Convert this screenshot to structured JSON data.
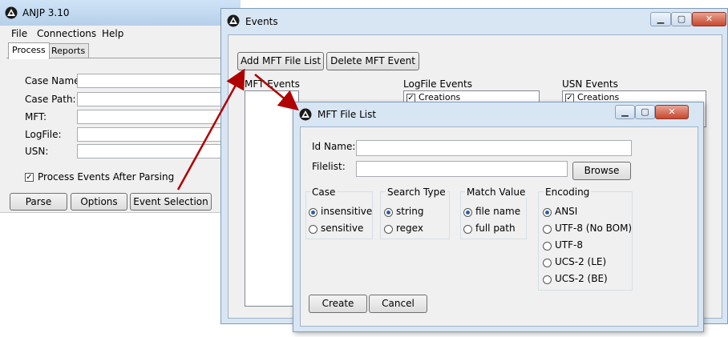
{
  "main_window": {
    "title": "ANJP 3.10",
    "menu": [
      "File",
      "Connections",
      "Help"
    ],
    "tabs": [
      "Process",
      "Reports"
    ],
    "fields": [
      {
        "label": "Case Name:",
        "value": ""
      },
      {
        "label": "Case Path:",
        "value": ""
      },
      {
        "label": "MFT:",
        "value": ""
      },
      {
        "label": "LogFile:",
        "value": ""
      },
      {
        "label": "USN:",
        "value": ""
      }
    ],
    "process_after_parsing": {
      "label": "Process Events After Parsing",
      "checked": true
    },
    "buttons": {
      "parse": "Parse",
      "options": "Options",
      "event_selection": "Event Selection"
    }
  },
  "events_window": {
    "title": "Events",
    "buttons": {
      "add_mft": "Add MFT File List",
      "delete_mft": "Delete MFT Event"
    },
    "groups": {
      "mft": "MFT Events",
      "logfile": "LogFile Events",
      "usn": "USN Events"
    },
    "logfile_items": [
      {
        "label": "Creations",
        "checked": true
      }
    ],
    "usn_items": [
      {
        "label": "Creations",
        "checked": true
      }
    ]
  },
  "mft_dialog": {
    "title": "MFT File List",
    "id_name_label": "Id Name:",
    "id_name_value": "",
    "filelist_label": "Filelist:",
    "filelist_value": "",
    "browse": "Browse",
    "case": {
      "title": "Case",
      "options": [
        "insensitive",
        "sensitive"
      ],
      "selected": "insensitive"
    },
    "search_type": {
      "title": "Search Type",
      "options": [
        "string",
        "regex"
      ],
      "selected": "string"
    },
    "match_value": {
      "title": "Match Value",
      "options": [
        "file name",
        "full path"
      ],
      "selected": "file name"
    },
    "encoding": {
      "title": "Encoding",
      "options": [
        "ANSI",
        "UTF-8 (No BOM)",
        "UTF-8",
        "UCS-2 (LE)",
        "UCS-2 (BE)"
      ],
      "selected": "ANSI"
    },
    "create": "Create",
    "cancel": "Cancel"
  },
  "colors": {
    "arrow": "#b00000",
    "title_bar": "#c6dbf1",
    "radio_dot": "#2d5ea7"
  }
}
